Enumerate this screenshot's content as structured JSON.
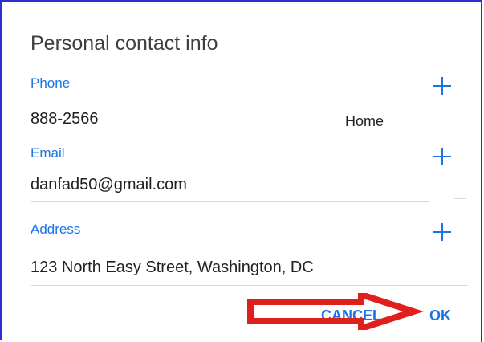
{
  "dialog": {
    "title": "Personal contact info",
    "phone": {
      "label": "Phone",
      "value": "888-2566",
      "type": "Home"
    },
    "email": {
      "label": "Email",
      "value": "danfad50@gmail.com"
    },
    "address": {
      "label": "Address",
      "value": "123 North Easy Street, Washington, DC"
    },
    "cancel_label": "CANCEL",
    "ok_label": "OK"
  },
  "colors": {
    "accent": "#1a73e8",
    "arrow": "#e0201c",
    "frame": "#2b2fd1"
  },
  "icons": [
    "plus-icon",
    "arrow-icon"
  ]
}
